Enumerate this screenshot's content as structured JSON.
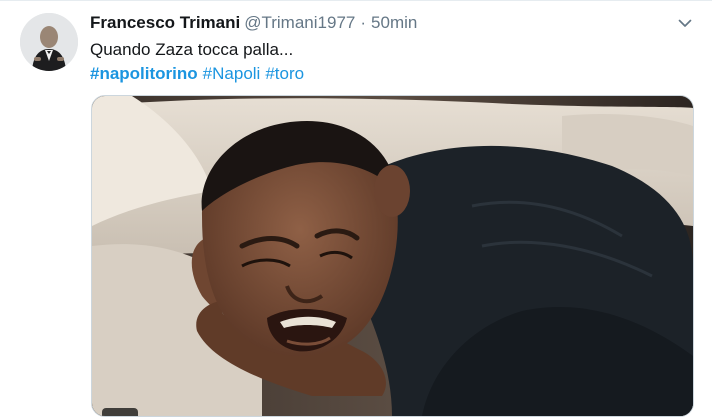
{
  "tweet": {
    "author_name": "Francesco Trimani",
    "handle": "@Trimani1977",
    "separator": "·",
    "time": "50min",
    "text": "Quando Zaza tocca palla...",
    "hashtags": [
      "#napolitorino",
      "#Napoli",
      "#toro"
    ]
  },
  "icons": {
    "more": "chevron-down-icon"
  },
  "colors": {
    "link": "#1b95e0",
    "secondary_text": "#657786",
    "border": "#ccd6dd"
  }
}
